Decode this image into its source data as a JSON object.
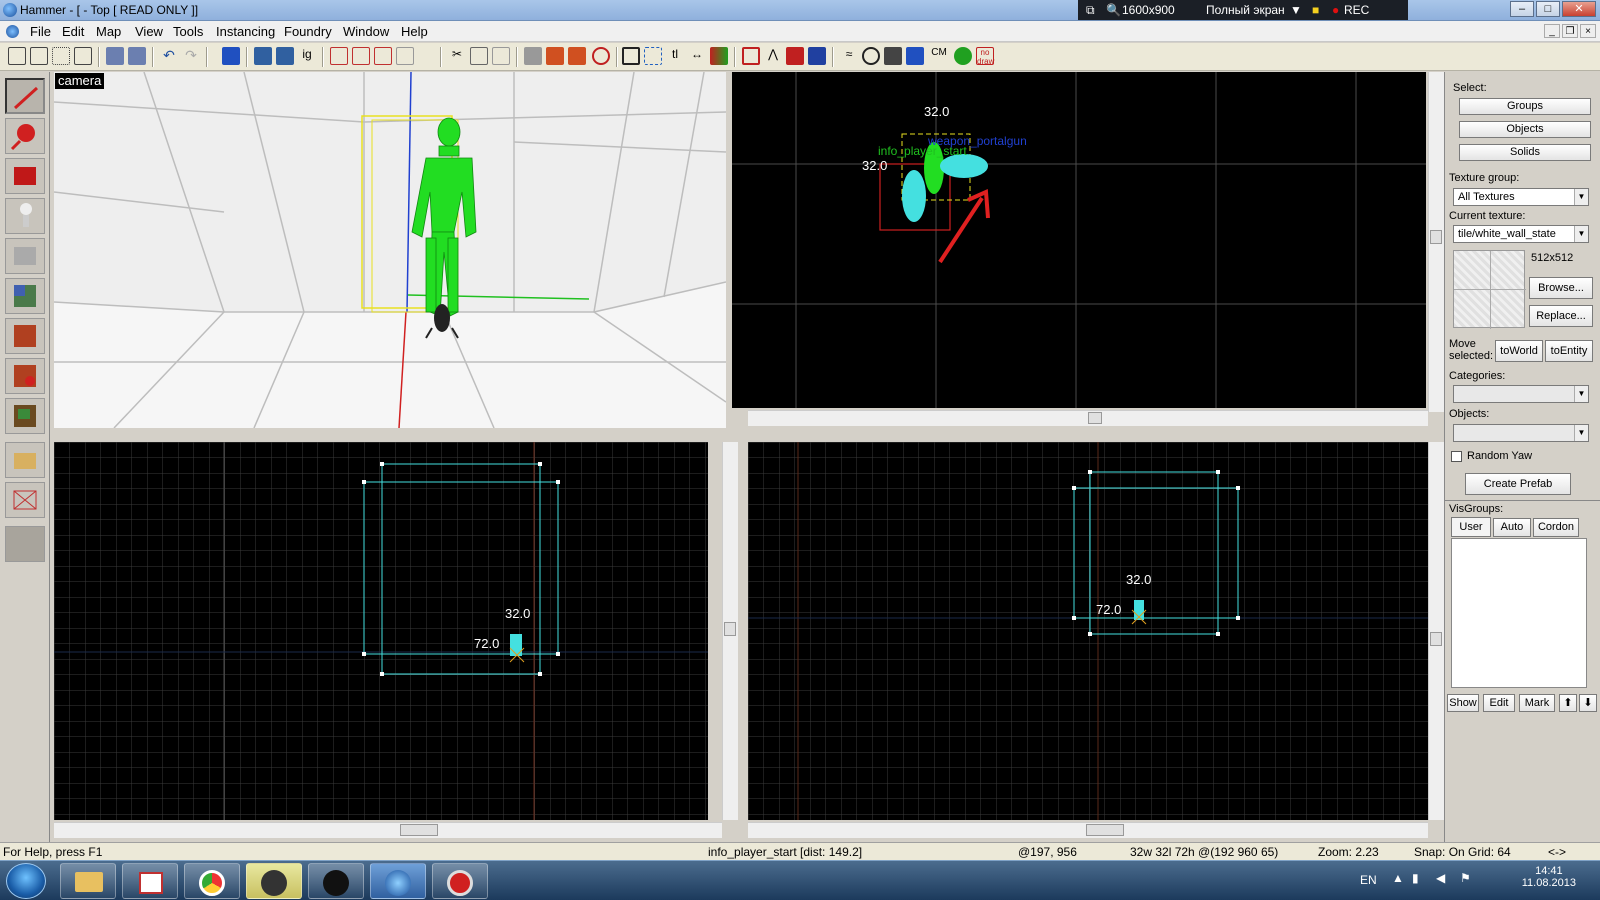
{
  "window": {
    "title": "Hammer - [ - Top [ READ ONLY ]]"
  },
  "recorder": {
    "resolution": "1600x900",
    "mode": "Полный экран",
    "rec": "REC"
  },
  "menu": [
    "File",
    "Edit",
    "Map",
    "View",
    "Tools",
    "Instancing",
    "Foundry",
    "Window",
    "Help"
  ],
  "camera_view": {
    "label": "camera"
  },
  "top_view": {
    "dim_x": "32.0",
    "dim_y": "32.0",
    "entity_player": "info_player_start",
    "entity_weapon": "weapon_portalgun"
  },
  "front_view": {
    "dim_w": "32.0",
    "dim_h": "72.0"
  },
  "side_view": {
    "dim_w": "32.0",
    "dim_h": "72.0"
  },
  "right_panel": {
    "select_label": "Select:",
    "groups": "Groups",
    "objects_btn": "Objects",
    "solids": "Solids",
    "texture_group_label": "Texture group:",
    "texture_group_value": "All Textures",
    "current_texture_label": "Current texture:",
    "current_texture_value": "tile/white_wall_state",
    "texture_size": "512x512",
    "browse": "Browse...",
    "replace": "Replace...",
    "move_selected": "Move selected:",
    "to_world": "toWorld",
    "to_entity": "toEntity",
    "categories_label": "Categories:",
    "objects_label": "Objects:",
    "random_yaw": "Random Yaw",
    "create_prefab": "Create Prefab",
    "visgroups_label": "VisGroups:",
    "tab_user": "User",
    "tab_auto": "Auto",
    "tab_cordon": "Cordon",
    "show": "Show",
    "edit": "Edit",
    "mark": "Mark"
  },
  "status": {
    "help": "For Help, press F1",
    "entity": "info_player_start   [dist: 149.2]",
    "pos": "@197, 956",
    "size": "32w 32l 72h @(192 960 65)",
    "zoom": "Zoom: 2.23",
    "snap": "Snap: On Grid: 64",
    "arrows": "<->"
  },
  "taskbar": {
    "lang": "EN",
    "time": "14:41",
    "date": "11.08.2013"
  },
  "colors": {
    "grid": "#4a4a4a",
    "selection_cyan": "#44e0e0",
    "model_green": "#22dd22",
    "bbox_yellow": "#e8e020"
  }
}
